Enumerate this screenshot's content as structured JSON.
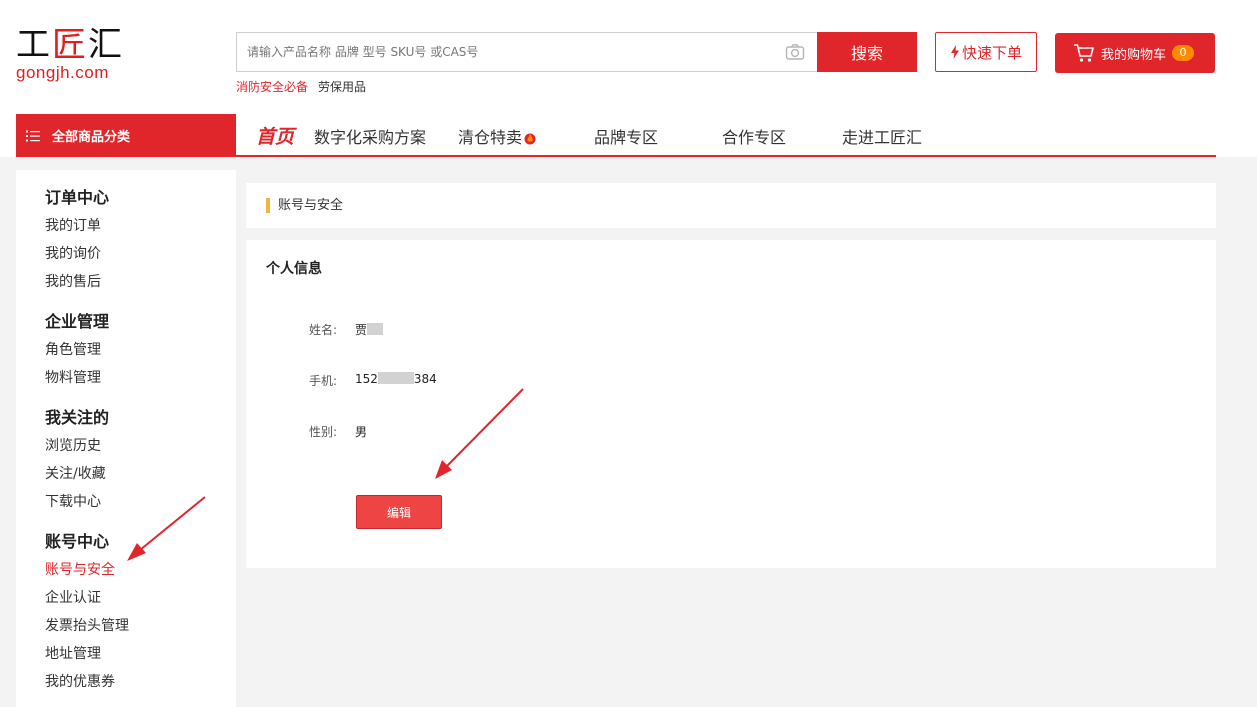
{
  "logo": {
    "cn_part1": "工",
    "cn_part2": "匠",
    "cn_part3": "汇",
    "en": "gongjh.com"
  },
  "search": {
    "placeholder": "请输入产品名称 品牌 型号 SKU号 或CAS号",
    "value": "",
    "button_label": "搜索"
  },
  "quick_order": {
    "label": "快速下单"
  },
  "cart": {
    "label": "我的购物车",
    "count": "0"
  },
  "hot_links": [
    {
      "label": "消防安全必备"
    },
    {
      "label": "劳保用品"
    }
  ],
  "all_categories": {
    "label": "全部商品分类"
  },
  "nav": [
    {
      "label": "首页"
    },
    {
      "label": "数字化采购方案"
    },
    {
      "label": "清仓特卖"
    },
    {
      "label": "品牌专区"
    },
    {
      "label": "合作专区"
    },
    {
      "label": "走进工匠汇"
    }
  ],
  "sidebar": {
    "groups": [
      {
        "title": "订单中心",
        "items": [
          "我的订单",
          "我的询价",
          "我的售后"
        ]
      },
      {
        "title": "企业管理",
        "items": [
          "角色管理",
          "物料管理"
        ]
      },
      {
        "title": "我关注的",
        "items": [
          "浏览历史",
          "关注/收藏",
          "下载中心"
        ]
      },
      {
        "title": "账号中心",
        "items": [
          "账号与安全",
          "企业认证",
          "发票抬头管理",
          "地址管理",
          "我的优惠券"
        ]
      }
    ],
    "active_item": "账号与安全"
  },
  "breadcrumb": {
    "label": "账号与安全"
  },
  "profile": {
    "title": "个人信息",
    "name_label": "姓名:",
    "name_value": "贾",
    "phone_label": "手机:",
    "phone_prefix": "152",
    "phone_suffix": "384",
    "gender_label": "性别:",
    "gender_value": "男",
    "edit_label": "编辑"
  },
  "colors": {
    "brand_red": "#e0262a",
    "accent_orange": "#ff8a00",
    "crumb_yellow": "#f5b342",
    "edit_button": "#ef4444",
    "page_bg": "#f3f3f3"
  },
  "icons": [
    "camera-icon",
    "bolt-icon",
    "cart-icon",
    "menu-icon",
    "fire-icon",
    "arrow-annotation"
  ]
}
